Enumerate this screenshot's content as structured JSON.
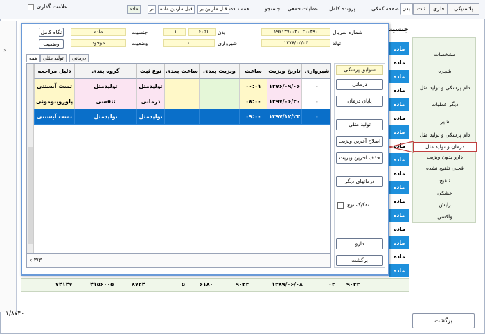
{
  "outer": {
    "top_tabs": [
      "پلاستیکی",
      "فلزی",
      "ثبت",
      "بدن"
    ],
    "top_menu": [
      "صفحه کمکی",
      "پرونده کامل",
      "عملیات جمعی",
      "جستجو",
      "همه داده‌ها"
    ],
    "top_chips": [
      "قبل مارتین بر",
      "قبل مارتین ماده",
      "نر",
      "ماده"
    ],
    "bookmark_label": "علامت گذاری",
    "sidebar": [
      "مشخصات",
      "شجره",
      "دام پزشکی و تولید مثل",
      "دیگر عملیات",
      "شیر",
      "دام پزشکی و تولید مثل",
      "درمان و تولید مثل",
      "دارو بدون ویزیت",
      "فحلی تلقیح نشده",
      "تلقیح",
      "خشکی",
      "زایش",
      "واکسن"
    ],
    "sidebar_selected": 6,
    "gender_header": "جنسیت",
    "gender_values": [
      "ماده",
      "ماده",
      "ماده",
      "ماده",
      "ماده",
      "ماده",
      "ماده",
      "ماده",
      "ماده",
      "ماده",
      "ماده",
      "ماده",
      "ماده",
      "ماده",
      "ماده",
      "ماده",
      "ماده"
    ],
    "totals": [
      "۹۰۳۳",
      "۰۲",
      "۱۳۸۹/۰۶/۰۸",
      "۹۰۲۲",
      "۶۱۸۰",
      "۵",
      "۸۷۲۴",
      "۴۱۵۶۰۰۵",
      "۷۴۱۴۷"
    ],
    "footer_total": "۱/۸۷۴۰",
    "back_label": "برگشت"
  },
  "dialog": {
    "serial_label": "شماره سریال",
    "serial_value": "۱۹۶۱۳۷۰۰۲۰۰۲۰۰۳۹۰",
    "body_label": "بدن",
    "body_value": "۰۶۰۵۱",
    "num_value": "۰۱",
    "gender_label": "جنسیت",
    "gender_value": "ماده",
    "birth_label": "تولد",
    "birth_value": "۱۳۷۶/۰۲/۰۴",
    "lactation_label": "شیرواری",
    "lactation_value": "۰",
    "status_label": "وضعیت",
    "status_value": "موجود",
    "full_view_label": "نگاه کامل",
    "status_button_label": "وضعیت",
    "tabs": [
      "همه",
      "تولید مثلی",
      "درمانی"
    ],
    "tab_selected": 0,
    "columns": [
      "شیرواری",
      "تاریخ ویزیت",
      "ساعت",
      "ویزیت بعدی",
      "ساعت بعدی",
      "نوع ثبت",
      "گروه بندی",
      "دلیل مراجعه"
    ],
    "rows": [
      [
        "۰",
        "۱۳۷۶/۰۹/۰۶",
        "۰۰:۰۱",
        "",
        "",
        "تولیدمثل",
        "تولیدمثل",
        "تست آبستنی"
      ],
      [
        "۰",
        "۱۳۹۷/۰۶/۲۰",
        "۰۸:۰۰",
        "",
        "",
        "درمانی",
        "تنفسی",
        "پلوروپنومونی"
      ],
      [
        "۰",
        "۱۳۹۷/۱۲/۲۳",
        "۰۹:۰۰",
        "",
        "",
        "تولیدمثل",
        "تولیدمثل",
        "تست آبستنی"
      ]
    ],
    "selected_row": 2,
    "pager": "۳/۳",
    "buttons_panel_title": "سوابق پزشکی",
    "buttons": [
      "درمانی",
      "پایان درمان",
      "تولید مثلی",
      "اصلاح آخرین ویزیت",
      "حذف آخرین ویزیت",
      "درمانهای دیگر"
    ],
    "split_label": "تفکیک نوع",
    "drug_label": "دارو",
    "back_label": "برگشت"
  }
}
